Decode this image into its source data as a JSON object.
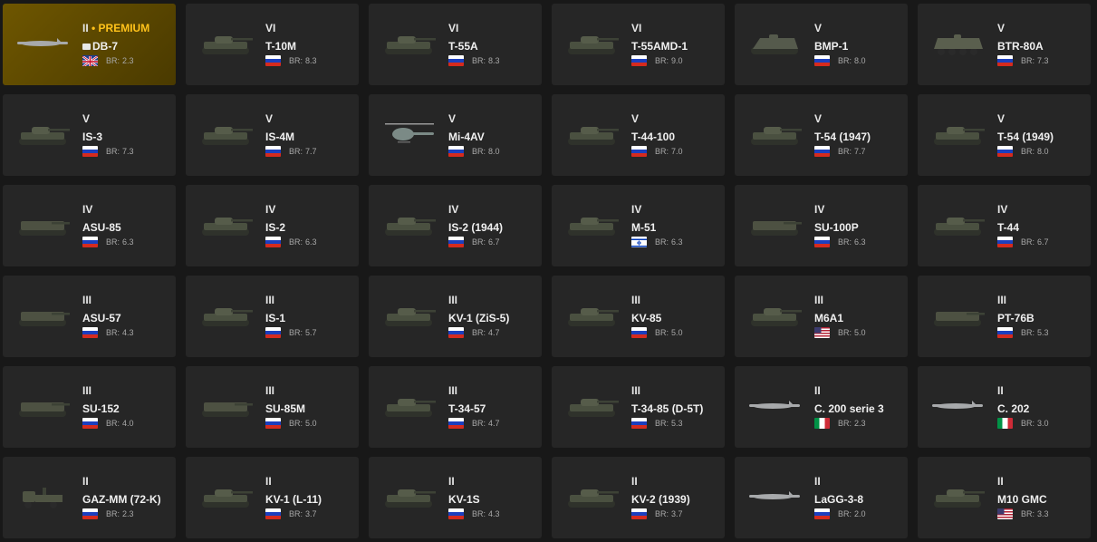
{
  "vehicles": [
    {
      "rank": "II",
      "premium": "PREMIUM",
      "name": "DB-7",
      "br_label": "BR:",
      "br": "2.3",
      "flag": "uk",
      "flag_icon": "uk-flag-icon",
      "icon": "db-7-aircraft-icon",
      "kind": "plane",
      "colors": {
        "accent": "#ffc21a",
        "card": "#6e5600"
      }
    },
    {
      "rank": "VI",
      "name": "T-10M",
      "br_label": "BR:",
      "br": "8.3",
      "flag": "ussr",
      "flag_icon": "ussr-flag-icon",
      "icon": "t-10m-tank-icon",
      "kind": "tank"
    },
    {
      "rank": "VI",
      "name": "T-55A",
      "br_label": "BR:",
      "br": "8.3",
      "flag": "ussr",
      "flag_icon": "ussr-flag-icon",
      "icon": "t-55a-tank-icon",
      "kind": "tank"
    },
    {
      "rank": "VI",
      "name": "T-55AMD-1",
      "br_label": "BR:",
      "br": "9.0",
      "flag": "ussr",
      "flag_icon": "ussr-flag-icon",
      "icon": "t-55amd-1-tank-icon",
      "kind": "tank"
    },
    {
      "rank": "V",
      "name": "BMP-1",
      "br_label": "BR:",
      "br": "8.0",
      "flag": "ussr",
      "flag_icon": "ussr-flag-icon",
      "icon": "bmp-1-ifv-icon",
      "kind": "ifv"
    },
    {
      "rank": "V",
      "name": "BTR-80A",
      "br_label": "BR:",
      "br": "7.3",
      "flag": "ussr",
      "flag_icon": "ussr-flag-icon",
      "icon": "btr-80a-apc-icon",
      "kind": "apc"
    },
    {
      "rank": "V",
      "name": "IS-3",
      "br_label": "BR:",
      "br": "7.3",
      "flag": "ussr",
      "flag_icon": "ussr-flag-icon",
      "icon": "is-3-tank-icon",
      "kind": "tank"
    },
    {
      "rank": "V",
      "name": "IS-4M",
      "br_label": "BR:",
      "br": "7.7",
      "flag": "ussr",
      "flag_icon": "ussr-flag-icon",
      "icon": "is-4m-tank-icon",
      "kind": "tank"
    },
    {
      "rank": "V",
      "name": "Mi-4AV",
      "br_label": "BR:",
      "br": "8.0",
      "flag": "ussr",
      "flag_icon": "ussr-flag-icon",
      "icon": "mi-4av-helicopter-icon",
      "kind": "heli"
    },
    {
      "rank": "V",
      "name": "T-44-100",
      "br_label": "BR:",
      "br": "7.0",
      "flag": "ussr",
      "flag_icon": "ussr-flag-icon",
      "icon": "t-44-100-tank-icon",
      "kind": "tank"
    },
    {
      "rank": "V",
      "name": "T-54 (1947)",
      "br_label": "BR:",
      "br": "7.7",
      "flag": "ussr",
      "flag_icon": "ussr-flag-icon",
      "icon": "t-54-1947-tank-icon",
      "kind": "tank"
    },
    {
      "rank": "V",
      "name": "T-54 (1949)",
      "br_label": "BR:",
      "br": "8.0",
      "flag": "ussr",
      "flag_icon": "ussr-flag-icon",
      "icon": "t-54-1949-tank-icon",
      "kind": "tank"
    },
    {
      "rank": "IV",
      "name": "ASU-85",
      "br_label": "BR:",
      "br": "6.3",
      "flag": "ussr",
      "flag_icon": "ussr-flag-icon",
      "icon": "asu-85-spg-icon",
      "kind": "spg"
    },
    {
      "rank": "IV",
      "name": "IS-2",
      "br_label": "BR:",
      "br": "6.3",
      "flag": "ussr",
      "flag_icon": "ussr-flag-icon",
      "icon": "is-2-tank-icon",
      "kind": "tank"
    },
    {
      "rank": "IV",
      "name": "IS-2 (1944)",
      "br_label": "BR:",
      "br": "6.7",
      "flag": "ussr",
      "flag_icon": "ussr-flag-icon",
      "icon": "is-2-1944-tank-icon",
      "kind": "tank"
    },
    {
      "rank": "IV",
      "name": "M-51",
      "br_label": "BR:",
      "br": "6.3",
      "flag": "israel",
      "flag_icon": "israel-flag-icon",
      "icon": "m-51-tank-icon",
      "kind": "tank"
    },
    {
      "rank": "IV",
      "name": "SU-100P",
      "br_label": "BR:",
      "br": "6.3",
      "flag": "ussr",
      "flag_icon": "ussr-flag-icon",
      "icon": "su-100p-spg-icon",
      "kind": "spg"
    },
    {
      "rank": "IV",
      "name": "T-44",
      "br_label": "BR:",
      "br": "6.7",
      "flag": "ussr",
      "flag_icon": "ussr-flag-icon",
      "icon": "t-44-tank-icon",
      "kind": "tank"
    },
    {
      "rank": "III",
      "name": "ASU-57",
      "br_label": "BR:",
      "br": "4.3",
      "flag": "ussr",
      "flag_icon": "ussr-flag-icon",
      "icon": "asu-57-spg-icon",
      "kind": "spg"
    },
    {
      "rank": "III",
      "name": "IS-1",
      "br_label": "BR:",
      "br": "5.7",
      "flag": "ussr",
      "flag_icon": "ussr-flag-icon",
      "icon": "is-1-tank-icon",
      "kind": "tank"
    },
    {
      "rank": "III",
      "name": "KV-1 (ZiS-5)",
      "br_label": "BR:",
      "br": "4.7",
      "flag": "ussr",
      "flag_icon": "ussr-flag-icon",
      "icon": "kv-1-zis-5-tank-icon",
      "kind": "tank"
    },
    {
      "rank": "III",
      "name": "KV-85",
      "br_label": "BR:",
      "br": "5.0",
      "flag": "ussr",
      "flag_icon": "ussr-flag-icon",
      "icon": "kv-85-tank-icon",
      "kind": "tank"
    },
    {
      "rank": "III",
      "name": "M6A1",
      "br_label": "BR:",
      "br": "5.0",
      "flag": "usa",
      "flag_icon": "usa-flag-icon",
      "icon": "m6a1-tank-icon",
      "kind": "tank"
    },
    {
      "rank": "III",
      "name": "PT-76B",
      "br_label": "BR:",
      "br": "5.3",
      "flag": "ussr",
      "flag_icon": "ussr-flag-icon",
      "icon": "pt-76b-tank-icon",
      "kind": "spg"
    },
    {
      "rank": "III",
      "name": "SU-152",
      "br_label": "BR:",
      "br": "4.0",
      "flag": "ussr",
      "flag_icon": "ussr-flag-icon",
      "icon": "su-152-spg-icon",
      "kind": "spg"
    },
    {
      "rank": "III",
      "name": "SU-85M",
      "br_label": "BR:",
      "br": "5.0",
      "flag": "ussr",
      "flag_icon": "ussr-flag-icon",
      "icon": "su-85m-spg-icon",
      "kind": "spg"
    },
    {
      "rank": "III",
      "name": "T-34-57",
      "br_label": "BR:",
      "br": "4.7",
      "flag": "ussr",
      "flag_icon": "ussr-flag-icon",
      "icon": "t-34-57-tank-icon",
      "kind": "tank"
    },
    {
      "rank": "III",
      "name": "T-34-85 (D-5T)",
      "br_label": "BR:",
      "br": "5.3",
      "flag": "ussr",
      "flag_icon": "ussr-flag-icon",
      "icon": "t-34-85-d-5t-tank-icon",
      "kind": "tank"
    },
    {
      "rank": "II",
      "name": "C. 200 serie 3",
      "br_label": "BR:",
      "br": "2.3",
      "flag": "italy",
      "flag_icon": "italy-flag-icon",
      "icon": "c-200-aircraft-icon",
      "kind": "plane"
    },
    {
      "rank": "II",
      "name": "C. 202",
      "br_label": "BR:",
      "br": "3.0",
      "flag": "italy",
      "flag_icon": "italy-flag-icon",
      "icon": "c-202-aircraft-icon",
      "kind": "plane"
    },
    {
      "rank": "II",
      "name": "GAZ-MM (72-K)",
      "br_label": "BR:",
      "br": "2.3",
      "flag": "ussr",
      "flag_icon": "ussr-flag-icon",
      "icon": "gaz-mm-truck-icon",
      "kind": "truck"
    },
    {
      "rank": "II",
      "name": "KV-1 (L-11)",
      "br_label": "BR:",
      "br": "3.7",
      "flag": "ussr",
      "flag_icon": "ussr-flag-icon",
      "icon": "kv-1-l-11-tank-icon",
      "kind": "tank"
    },
    {
      "rank": "II",
      "name": "KV-1S",
      "br_label": "BR:",
      "br": "4.3",
      "flag": "ussr",
      "flag_icon": "ussr-flag-icon",
      "icon": "kv-1s-tank-icon",
      "kind": "tank"
    },
    {
      "rank": "II",
      "name": "KV-2 (1939)",
      "br_label": "BR:",
      "br": "3.7",
      "flag": "ussr",
      "flag_icon": "ussr-flag-icon",
      "icon": "kv-2-1939-tank-icon",
      "kind": "tank"
    },
    {
      "rank": "II",
      "name": "LaGG-3-8",
      "br_label": "BR:",
      "br": "2.0",
      "flag": "ussr",
      "flag_icon": "ussr-flag-icon",
      "icon": "lagg-3-8-aircraft-icon",
      "kind": "plane"
    },
    {
      "rank": "II",
      "name": "M10 GMC",
      "br_label": "BR:",
      "br": "3.3",
      "flag": "usa",
      "flag_icon": "usa-flag-icon",
      "icon": "m10-gmc-tank-icon",
      "kind": "tank"
    }
  ]
}
